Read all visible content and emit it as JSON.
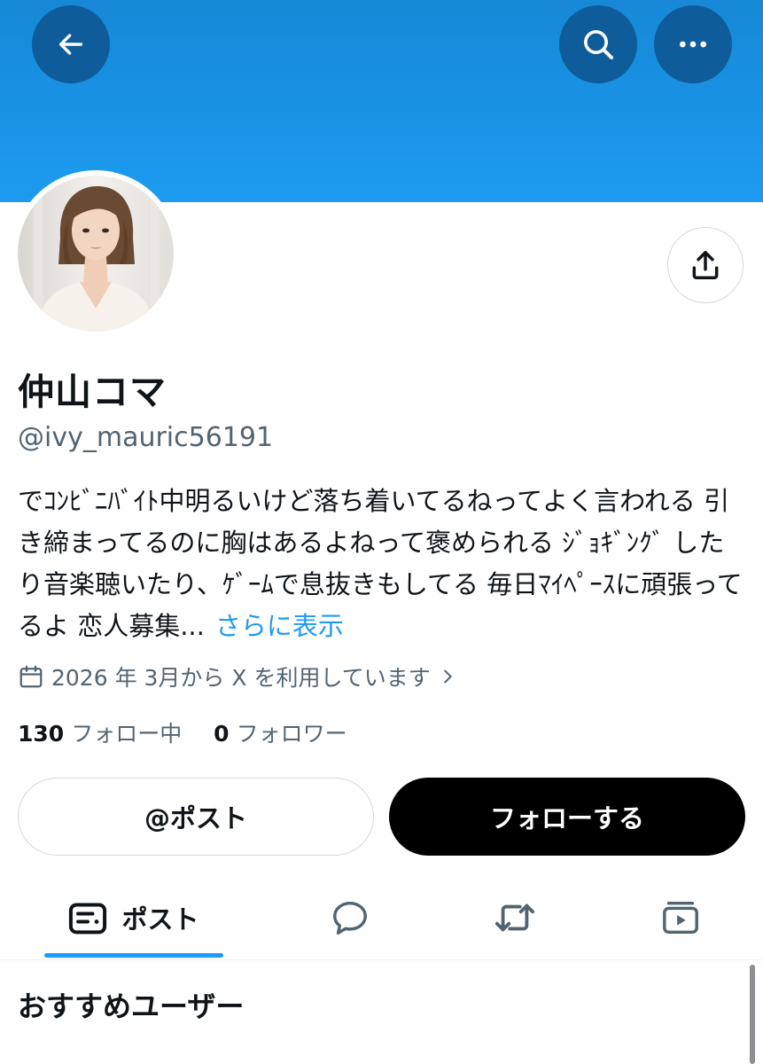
{
  "profile": {
    "display_name": "仲山コマ",
    "handle": "@ivy_mauric56191",
    "bio_text": "でｺﾝﾋﾞﾆﾊﾞｲﾄ中明るいけど落ち着いてるねってよく言われる 引き締まってるのに胸はあるよねって褒められる ｼﾞｮｷﾞﾝｸﾞ したり音楽聴いたり、ｹﾞｰﾑで息抜きもしてる 毎日ﾏｲﾍﾟｰｽに頑張ってるよ 恋人募集...",
    "bio_more": "さらに表示",
    "joined": "2026 年 3月から X を利用しています",
    "following_count": "130",
    "following_label": "フォロー中",
    "followers_count": "0",
    "followers_label": "フォロワー"
  },
  "header": {
    "back_icon": "arrow-left-icon",
    "search_icon": "search-icon",
    "more_icon": "more-horizontal-icon",
    "share_icon": "share-icon"
  },
  "actions": {
    "post_label": "@ポスト",
    "follow_label": "フォローする"
  },
  "tabs": [
    {
      "label": "ポスト",
      "icon": "posts-icon",
      "active": true
    },
    {
      "label": "",
      "icon": "replies-icon",
      "active": false
    },
    {
      "label": "",
      "icon": "repost-icon",
      "active": false
    },
    {
      "label": "",
      "icon": "media-icon",
      "active": false
    }
  ],
  "section": {
    "title": "おすすめユーザー"
  },
  "colors": {
    "banner": "#1d9bf0",
    "accent": "#1d9bf0",
    "follow_button": "#000000",
    "secondary_text": "#536471"
  }
}
